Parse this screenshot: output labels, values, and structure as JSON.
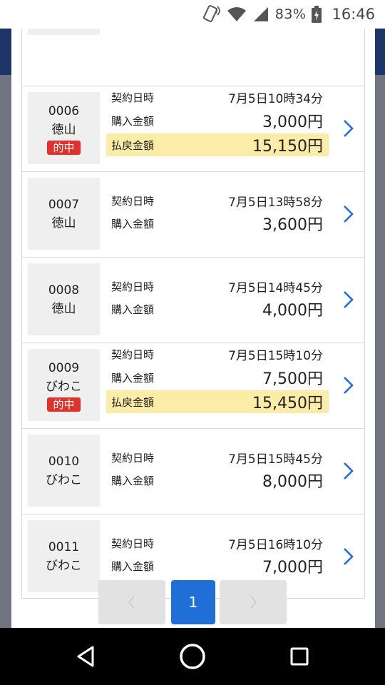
{
  "status_bar": {
    "battery_percent": "83%",
    "time": "16:46",
    "icons": [
      "vibrate-icon",
      "wifi-icon",
      "signal-icon",
      "battery-charging-icon"
    ]
  },
  "list": {
    "contract_label": "契約日時",
    "purchase_label": "購入金額",
    "payout_label": "払戻金額",
    "hit_badge": "的中",
    "items": [
      {
        "number": "0006",
        "venue": "徳山",
        "hit": true,
        "contract_time": "7月5日10時34分",
        "purchase": "3,000円",
        "payout": "15,150円"
      },
      {
        "number": "0007",
        "venue": "徳山",
        "hit": false,
        "contract_time": "7月5日13時58分",
        "purchase": "3,600円",
        "payout": ""
      },
      {
        "number": "0008",
        "venue": "徳山",
        "hit": false,
        "contract_time": "7月5日14時45分",
        "purchase": "4,000円",
        "payout": ""
      },
      {
        "number": "0009",
        "venue": "びわこ",
        "hit": true,
        "contract_time": "7月5日15時10分",
        "purchase": "7,500円",
        "payout": "15,450円"
      },
      {
        "number": "0010",
        "venue": "びわこ",
        "hit": false,
        "contract_time": "7月5日15時45分",
        "purchase": "8,000円",
        "payout": ""
      },
      {
        "number": "0011",
        "venue": "びわこ",
        "hit": false,
        "contract_time": "7月5日16時10分",
        "purchase": "7,000円",
        "payout": ""
      }
    ]
  },
  "pagination": {
    "current_page": "1",
    "prev_icon": "chevron-left-icon",
    "next_icon": "chevron-right-icon"
  },
  "colors": {
    "accent": "#1f6fd6",
    "hit_badge": "#e0322b",
    "payout_highlight": "#fbeca7"
  }
}
